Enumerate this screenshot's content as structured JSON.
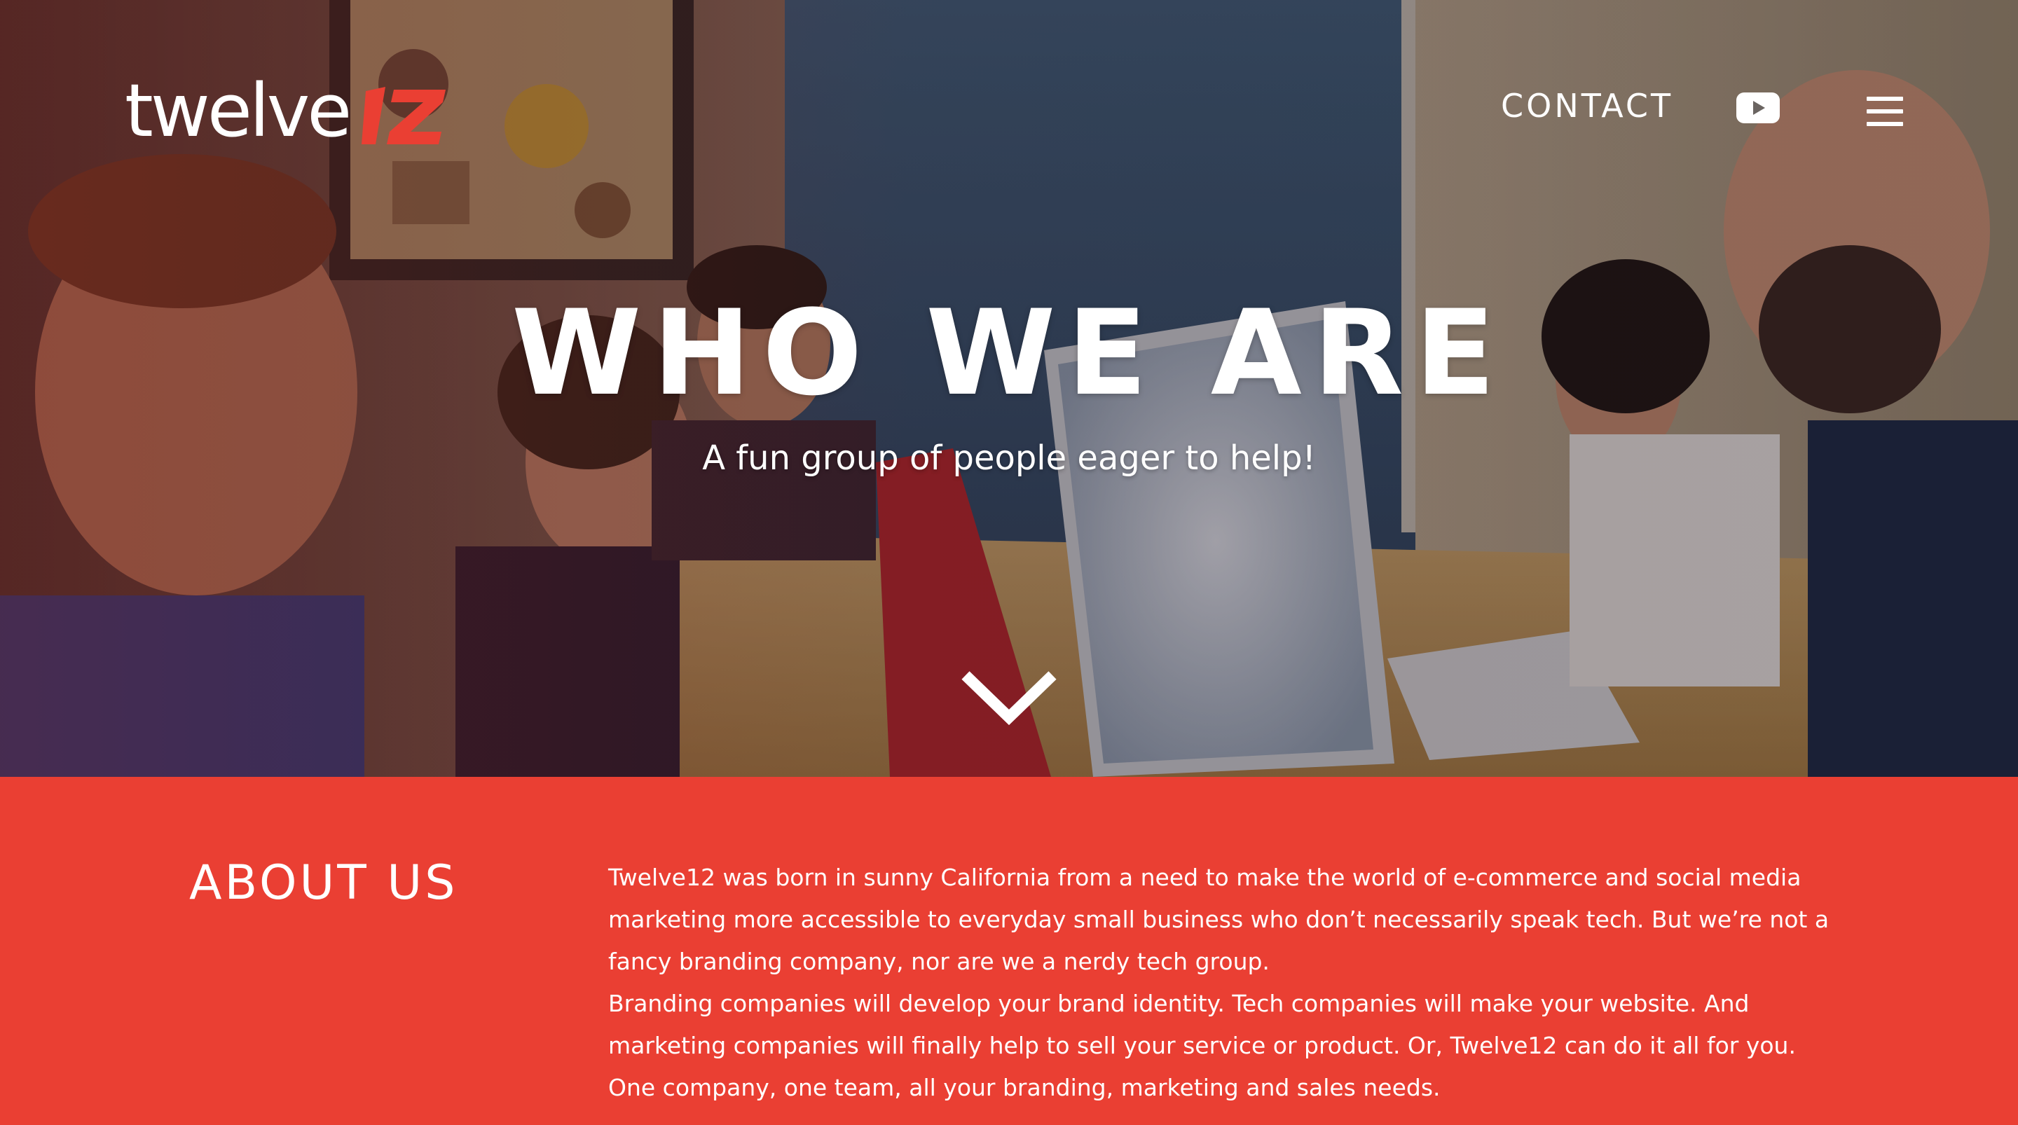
{
  "header": {
    "logo_text": "twelve",
    "logo_mark_text": "12",
    "contact_label": "CONTACT",
    "youtube_icon": "youtube-icon",
    "menu_icon": "hamburger-menu-icon"
  },
  "hero": {
    "title": "WHO WE ARE",
    "subtitle": "A fun group of people eager to help!",
    "scroll_icon": "chevron-down-icon"
  },
  "about": {
    "heading": "ABOUT US",
    "paragraphs": [
      "Twelve12 was born in sunny California from a need to make the world of e-commerce and social media marketing more accessible to everyday small business who don’t necessarily speak tech. But we’re not a fancy branding company, nor are we a nerdy tech group.",
      "Branding companies will develop your brand identity. Tech companies will make your website. And marketing companies will finally help to sell your service or product. Or, Twelve12 can do it all for you.",
      "One company, one team, all your branding, marketing and sales needs."
    ]
  },
  "colors": {
    "brand_red": "#ea3f33",
    "text_white": "#ffffff"
  }
}
